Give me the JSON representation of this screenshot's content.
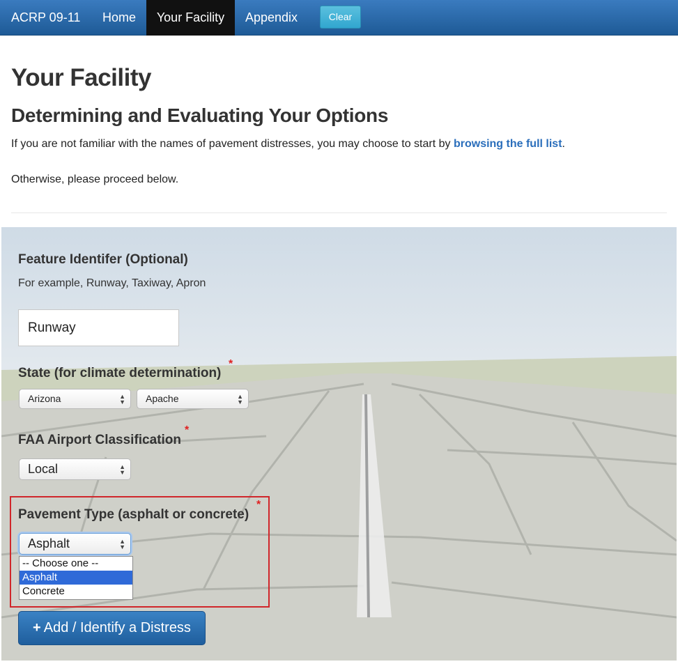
{
  "navbar": {
    "brand": "ACRP 09-11",
    "items": [
      {
        "label": "Home"
      },
      {
        "label": "Your Facility"
      },
      {
        "label": "Appendix"
      }
    ],
    "clear_label": "Clear",
    "bg_color": "#2a6aa8",
    "active_color": "#111111",
    "clear_color": "#5bc0de"
  },
  "header": {
    "title": "Your Facility",
    "subtitle": "Determining and Evaluating Your Options",
    "intro_text": "If you are not familiar with the names of pavement distresses, you may choose to start by ",
    "intro_link": "browsing the full list",
    "intro_end": ".",
    "proceed_text": "Otherwise, please proceed below."
  },
  "form": {
    "feature": {
      "label": "Feature Identifer (Optional)",
      "hint": "For example, Runway, Taxiway, Apron",
      "value": "Runway"
    },
    "state": {
      "label": "State (for climate determination)",
      "required_mark": "*",
      "state_value": "Arizona",
      "county_value": "Apache"
    },
    "faa": {
      "label": "FAA Airport Classification",
      "required_mark": "*",
      "value": "Local"
    },
    "pavement": {
      "label": "Pavement Type (asphalt or concrete)",
      "required_mark": "*",
      "value": "Asphalt",
      "options": [
        "-- Choose one --",
        "Asphalt",
        "Concrete"
      ],
      "selected_option": "Asphalt"
    },
    "add_button": {
      "icon": "plus-icon",
      "label": "Add / Identify a Distress"
    },
    "required_color": "#e02020",
    "highlight_color": "#d0262a"
  }
}
